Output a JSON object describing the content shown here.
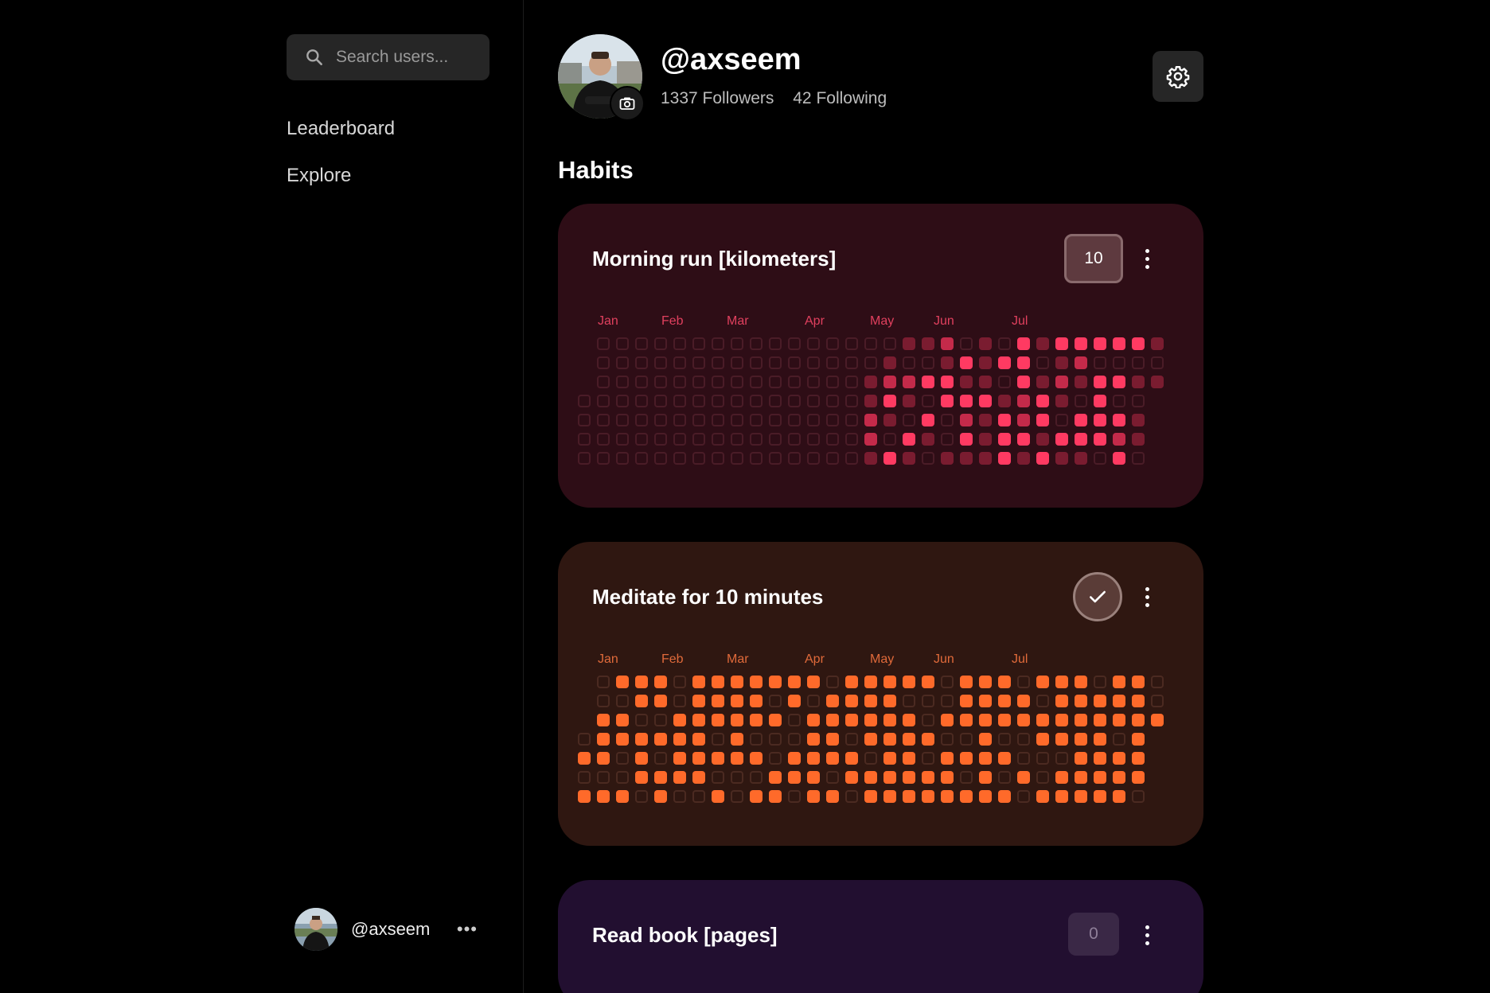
{
  "sidebar": {
    "search_placeholder": "Search users...",
    "nav": [
      "Leaderboard",
      "Explore"
    ],
    "user": {
      "handle": "@axseem"
    }
  },
  "profile": {
    "handle": "@axseem",
    "followers": "1337 Followers",
    "following": "42 Following"
  },
  "section_title": "Habits",
  "habits": [
    {
      "title": "Morning run [kilometers]",
      "action": "counter",
      "counter_value": "10",
      "theme": {
        "bg": "#2e0d16",
        "accent": "#ff3a62",
        "mid": "#c42a4a",
        "low": "#7a1c30",
        "empty_border": "#4a1c27",
        "month_color": "#e0405e"
      },
      "months": [
        "Jan",
        "Feb",
        "Mar",
        "Apr",
        "May",
        "Jun",
        "Jul"
      ]
    },
    {
      "title": "Meditate for 10 minutes",
      "action": "check",
      "theme": {
        "bg": "#2f1711",
        "accent": "#ff6a2a",
        "mid": "#ff6a2a",
        "low": "#ff6a2a",
        "empty_border": "#4b2a21",
        "month_color": "#e06a3a"
      },
      "months": [
        "Jan",
        "Feb",
        "Mar",
        "Apr",
        "May",
        "Jun",
        "Jul"
      ]
    },
    {
      "title": "Read book [pages]",
      "action": "counter",
      "counter_value": "0",
      "theme": {
        "bg": "#220f30",
        "accent": "#a56ad8"
      }
    }
  ],
  "icons": {
    "search": "search-icon",
    "camera": "camera-icon",
    "settings": "gear-icon",
    "check": "check-icon",
    "more": "more-vertical-icon",
    "more_h": "more-horizontal-icon"
  }
}
